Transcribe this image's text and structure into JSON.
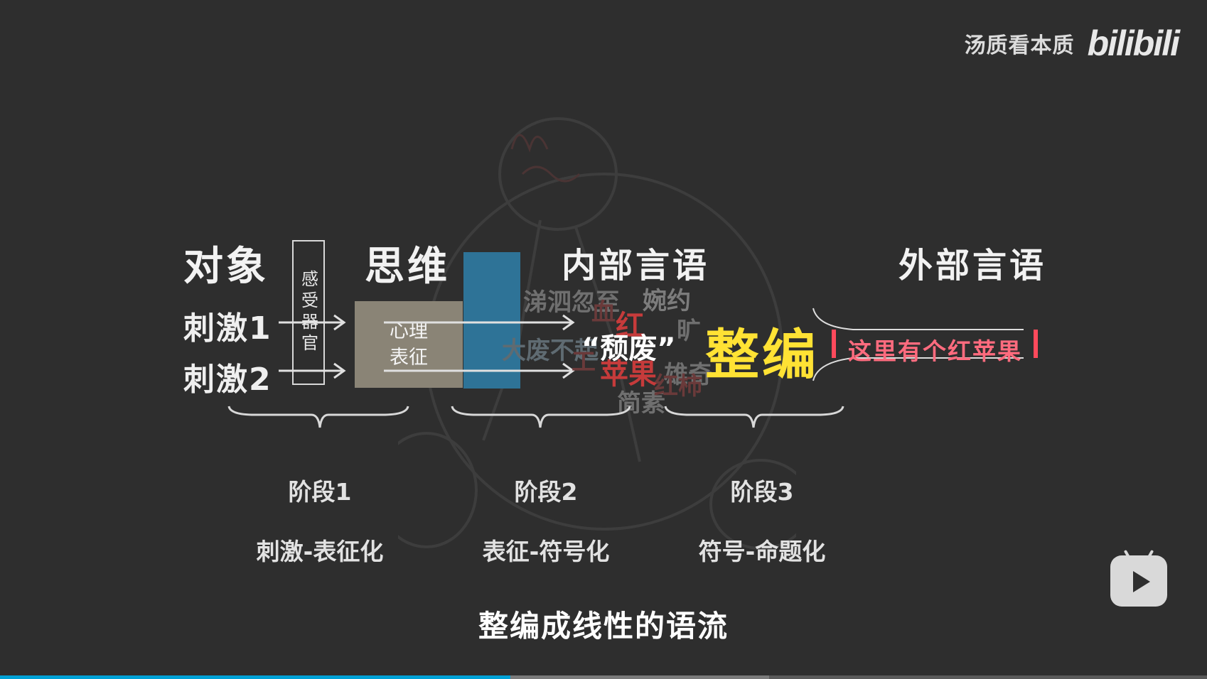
{
  "brand": {
    "channel": "汤质看本质",
    "logo": "bilibili"
  },
  "diagram": {
    "headings": {
      "object": "对象",
      "thinking": "思维",
      "inner_speech": "内部言语",
      "outer_speech": "外部言语"
    },
    "stimuli": [
      "刺激1",
      "刺激2"
    ],
    "receptor_label": "感受器官",
    "representation_label": "心理\n表征",
    "inner_words_grey": [
      "涕泗忽至",
      "婉约",
      "大废不起",
      "旷",
      "雄奇",
      "简素"
    ],
    "inner_words_red": [
      "红",
      "苹果"
    ],
    "inner_words_dim_red": [
      "血",
      "工",
      "红柿"
    ],
    "quoted_word": "“颓废”",
    "organize_label": "整编",
    "outer_sentence": "这里有个红苹果",
    "stages": [
      {
        "title": "阶段1",
        "desc": "刺激-表征化"
      },
      {
        "title": "阶段2",
        "desc": "表征-符号化"
      },
      {
        "title": "阶段3",
        "desc": "符号-命题化"
      }
    ]
  },
  "subtitle": "整编成线性的语流",
  "progress": {
    "played_fraction": 0.423,
    "buffered_fraction": 0.637
  },
  "colors": {
    "accent": "#00a1d6",
    "organize": "#ffe234",
    "outer": "#ff6b7e",
    "bar": "#2e7397"
  }
}
